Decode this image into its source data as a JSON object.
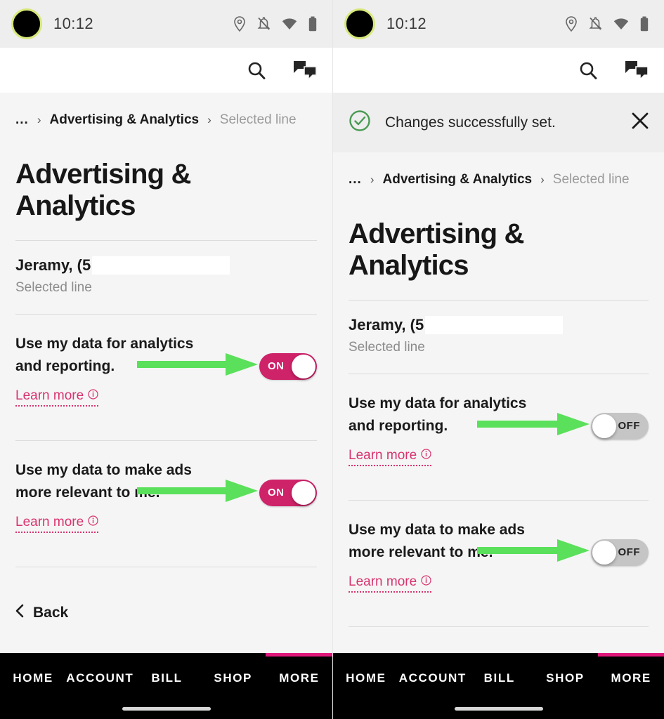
{
  "status_bar": {
    "time": "10:12",
    "icons": [
      "location-pin-icon",
      "notifications-off-icon",
      "wifi-icon",
      "battery-icon"
    ]
  },
  "app_bar": {
    "search_icon": "search-icon",
    "chat_icon": "chat-bubbles-icon"
  },
  "colors": {
    "accent_pink": "#ce2269",
    "link_pink": "#d8336e",
    "nav_indicator": "#e0187c",
    "success_green": "#4a9a52",
    "annotation_green": "#5ae05a",
    "toggle_off_track": "#c5c5c5",
    "page_bg": "#f5f5f5",
    "statusbar_bg": "#eeeeee",
    "nav_bg": "#000000"
  },
  "breadcrumb": {
    "ellipsis": "...",
    "separator": "›",
    "parent": "Advertising & Analytics",
    "current": "Selected line"
  },
  "page": {
    "title": "Advertising & Analytics",
    "line_name": "Jeramy,  (5",
    "line_sub": "Selected line",
    "back_label": "Back",
    "back_icon": "chevron-left-icon"
  },
  "settings": [
    {
      "label": "Use my data for analytics and reporting.",
      "learn_more": "Learn more",
      "info_icon": "info-circle-icon"
    },
    {
      "label": "Use my data to make ads more relevant to me.",
      "learn_more": "Learn more",
      "info_icon": "info-circle-icon"
    }
  ],
  "left_panel": {
    "toggle_states": [
      "ON",
      "ON"
    ]
  },
  "right_panel": {
    "banner": {
      "message": "Changes successfully set.",
      "check_icon": "check-circle-icon",
      "close_icon": "close-x-icon"
    },
    "toggle_states": [
      "OFF",
      "OFF"
    ]
  },
  "bottom_nav": {
    "items": [
      "HOME",
      "ACCOUNT",
      "BILL",
      "SHOP",
      "MORE"
    ],
    "active": "MORE"
  }
}
